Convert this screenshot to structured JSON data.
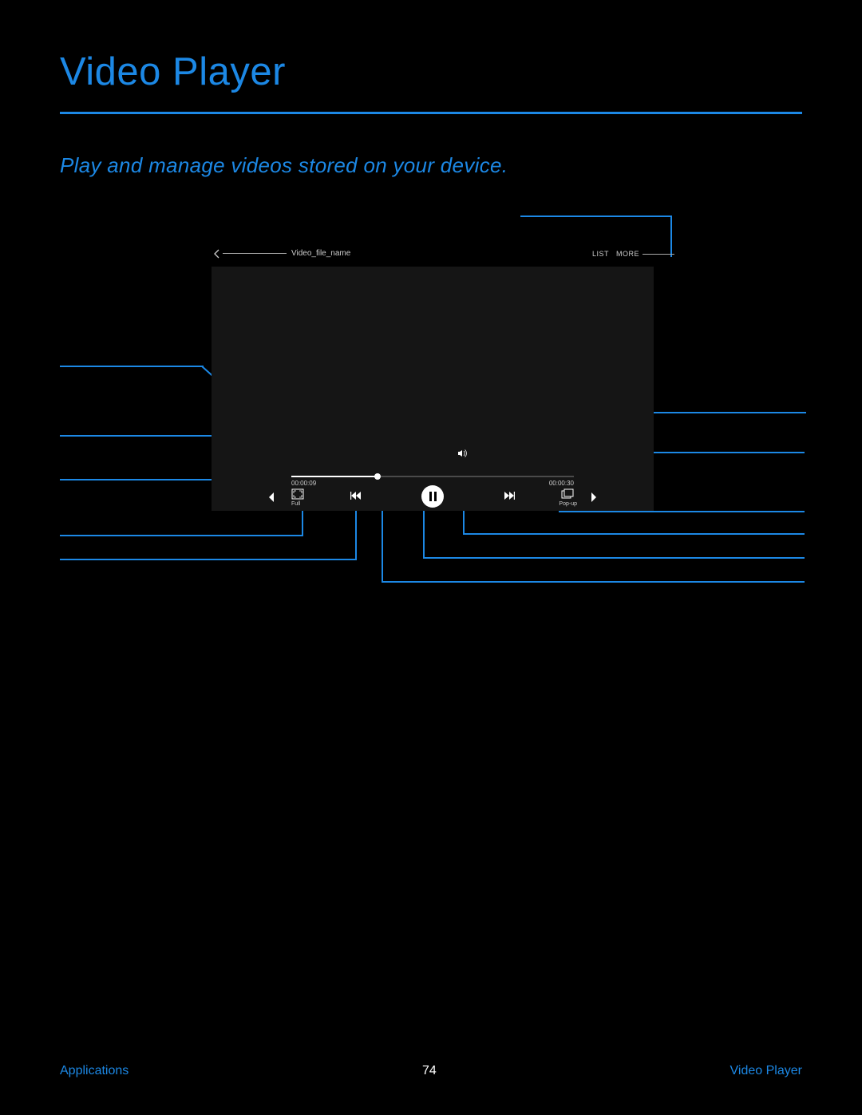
{
  "title": "Video Player",
  "subtitle": "Play and manage videos stored on your device.",
  "player": {
    "filename": "Video_file_name",
    "list_label": "LIST",
    "more_label": "MORE",
    "time_elapsed": "00:00:09",
    "time_total": "00:00:30",
    "full_label": "Full",
    "popup_label": "Pop-up"
  },
  "footer": {
    "left": "Applications",
    "page": "74",
    "right": "Video Player"
  },
  "colors": {
    "accent": "#1c88e5"
  }
}
